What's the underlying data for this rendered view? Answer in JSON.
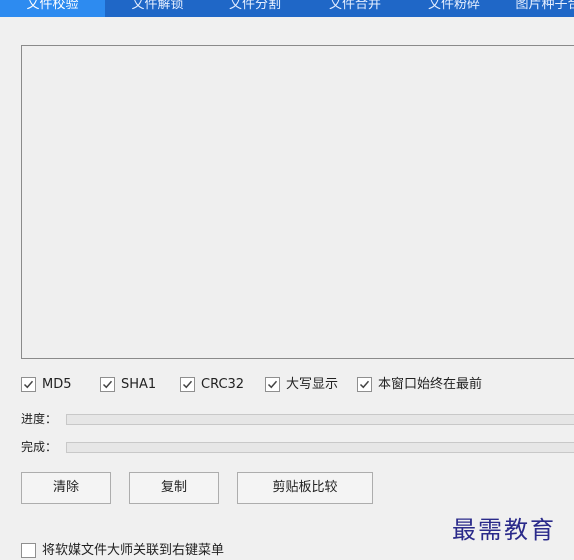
{
  "tabs": [
    {
      "label": "文件校验",
      "active": true
    },
    {
      "label": "文件解锁",
      "active": false
    },
    {
      "label": "文件分割",
      "active": false
    },
    {
      "label": "文件合并",
      "active": false
    },
    {
      "label": "文件粉碎",
      "active": false
    },
    {
      "label": "图片种子合",
      "active": false
    }
  ],
  "options": {
    "md5": {
      "label": "MD5",
      "checked": true
    },
    "sha1": {
      "label": "SHA1",
      "checked": true
    },
    "crc32": {
      "label": "CRC32",
      "checked": true
    },
    "uppercase": {
      "label": "大写显示",
      "checked": true
    },
    "always_on_top": {
      "label": "本窗口始终在最前",
      "checked": true
    }
  },
  "progress": {
    "label": "进度：",
    "value": 0
  },
  "complete": {
    "label": "完成：",
    "value": 0
  },
  "buttons": {
    "clear": "清除",
    "copy": "复制",
    "clipboard_compare": "剪贴板比较"
  },
  "context_menu_option": {
    "label": "将软媒文件大师关联到右键菜单",
    "checked": false
  },
  "watermark": "最需教育",
  "colors": {
    "tab_bar": "#1f67c7",
    "tab_active": "#2d8bf0",
    "watermark": "#2a2a8a"
  }
}
